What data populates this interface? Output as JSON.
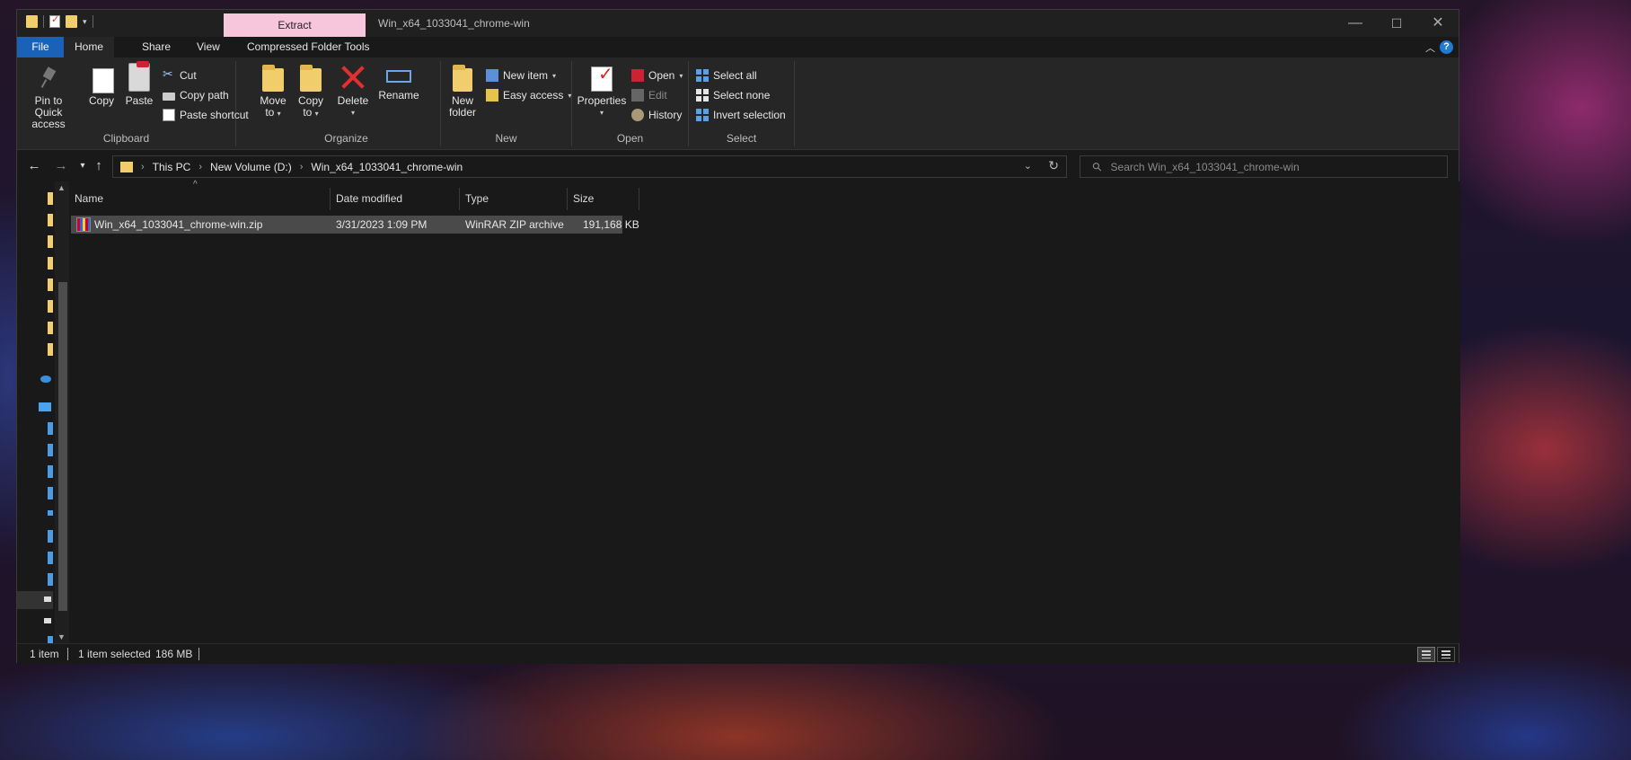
{
  "window": {
    "title": "Win_x64_1033041_chrome-win",
    "context_tab": "Extract"
  },
  "tabs": {
    "file": "File",
    "home": "Home",
    "share": "Share",
    "view": "View",
    "compressed_folder_tools": "Compressed Folder Tools",
    "help": "?"
  },
  "ribbon": {
    "clipboard": {
      "label": "Clipboard",
      "pin_to_quick_access_line1": "Pin to Quick",
      "pin_to_quick_access_line2": "access",
      "copy": "Copy",
      "paste": "Paste",
      "cut": "Cut",
      "copy_path": "Copy path",
      "paste_shortcut": "Paste shortcut"
    },
    "organize": {
      "label": "Organize",
      "move_to_line1": "Move",
      "move_to_line2": "to",
      "copy_to_line1": "Copy",
      "copy_to_line2": "to",
      "delete": "Delete",
      "rename": "Rename"
    },
    "new": {
      "label": "New",
      "new_folder_line1": "New",
      "new_folder_line2": "folder",
      "new_item": "New item",
      "easy_access": "Easy access"
    },
    "open": {
      "label": "Open",
      "properties": "Properties",
      "open": "Open",
      "edit": "Edit",
      "history": "History"
    },
    "select": {
      "label": "Select",
      "select_all": "Select all",
      "select_none": "Select none",
      "invert_selection": "Invert selection"
    }
  },
  "address": {
    "crumbs": [
      "This PC",
      "New Volume (D:)",
      "Win_x64_1033041_chrome-win"
    ],
    "search_placeholder": "Search Win_x64_1033041_chrome-win"
  },
  "columns": {
    "name": "Name",
    "date_modified": "Date modified",
    "type": "Type",
    "size": "Size"
  },
  "files": [
    {
      "name": "Win_x64_1033041_chrome-win.zip",
      "date_modified": "3/31/2023 1:09 PM",
      "type": "WinRAR ZIP archive",
      "size": "191,168 KB",
      "selected": true
    }
  ],
  "status": {
    "item_count": "1 item",
    "selection": "1 item selected",
    "selection_size": "186 MB"
  },
  "colors": {
    "file_tab": "#1a62b8",
    "context_tab": "#f7c6dc",
    "folder": "#f2cd6b",
    "selection": "#4a4a4a"
  }
}
